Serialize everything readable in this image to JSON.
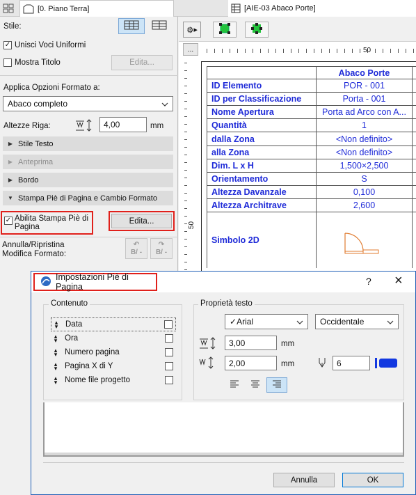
{
  "tabs": {
    "left": "[0. Piano Terra]",
    "right": "[AIE-03 Abaco Porte]"
  },
  "left": {
    "stile_label": "Stile:",
    "unisci": {
      "label": "Unisci Voci Uniformi",
      "checked": true
    },
    "mostra": {
      "label": "Mostra Titolo",
      "checked": false
    },
    "edita_disabled": "Edita...",
    "applica_label": "Applica Opzioni Formato a:",
    "formato_value": "Abaco completo",
    "altezze_label": "Altezze Riga:",
    "altezze_value": "4,00",
    "altezze_unit": "mm",
    "sections": [
      "Stile Testo",
      "Anteprima",
      "Bordo",
      "Stampa Piè di Pagina e Cambio Formato"
    ],
    "abilita_label": "Abilita Stampa Piè di Pagina",
    "abilita_checked": true,
    "edita_button": "Edita...",
    "annulla_label_1": "Annulla/Ripristina",
    "annulla_label_2": "Modifica Formato:",
    "undo_text": "B/ -",
    "redo_text": "B/ -"
  },
  "ruler": {
    "mark_top": "50",
    "mark_left": "50",
    "dots": "..."
  },
  "schedule": {
    "header": "Abaco Porte",
    "rows": [
      {
        "k": "ID Elemento",
        "v": "POR - 001"
      },
      {
        "k": "ID per Classificazione",
        "v": "Porta - 001"
      },
      {
        "k": "Nome Apertura",
        "v": "Porta ad Arco con A..."
      },
      {
        "k": "Quantità",
        "v": "1"
      },
      {
        "k": "dalla Zona",
        "v": "<Non definito>"
      },
      {
        "k": "alla Zona",
        "v": "<Non definito>"
      },
      {
        "k": "Dim. L x H",
        "v": "1,500×2,500"
      },
      {
        "k": "Orientamento",
        "v": "S"
      },
      {
        "k": "Altezza Davanzale",
        "v": "0,100"
      },
      {
        "k": "Altezza Architrave",
        "v": "2,600"
      }
    ],
    "simbolo": "Simbolo 2D"
  },
  "dialog": {
    "title": "Impostazioni Piè di Pagina",
    "help": "?",
    "close": "×",
    "contenuto_label": "Contenuto",
    "items": [
      "Data",
      "Ora",
      "Numero pagina",
      "Pagina X di Y",
      "Nome file progetto"
    ],
    "proprieta_label": "Proprietà testo",
    "font_value": "Arial",
    "script_value": "Occidentale",
    "size1": "3,00",
    "size2": "2,00",
    "unit": "mm",
    "pen": "6",
    "annulla": "Annulla",
    "ok": "OK"
  },
  "colors": {
    "accent": "#e0201b",
    "link_blue": "#1f2bd8",
    "dialog_border": "#1f5fb6"
  }
}
